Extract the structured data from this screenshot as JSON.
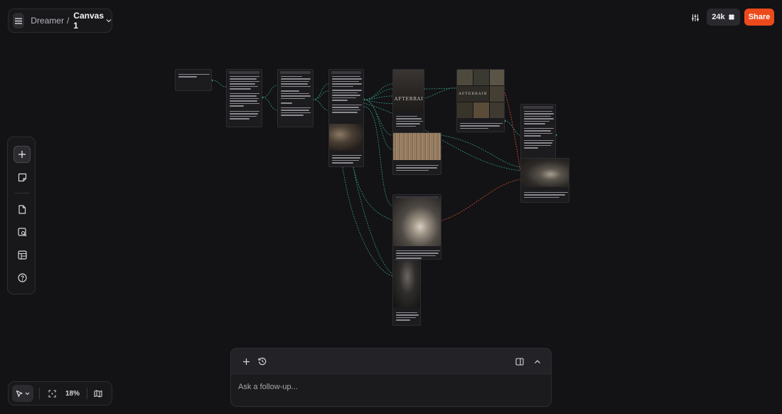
{
  "breadcrumb": {
    "root": "Dreamer",
    "separator": "/",
    "current": "Canvas 1"
  },
  "header": {
    "credits": "24k",
    "share_label": "Share"
  },
  "left_toolbar": {
    "items": [
      {
        "name": "add",
        "icon": "plus-icon"
      },
      {
        "name": "sticky-note",
        "icon": "sticky-note-icon"
      },
      {
        "name": "document",
        "icon": "document-icon"
      },
      {
        "name": "image-search",
        "icon": "image-search-icon"
      },
      {
        "name": "layout",
        "icon": "layout-icon"
      },
      {
        "name": "help",
        "icon": "help-icon"
      }
    ]
  },
  "zoom": {
    "level": "18%"
  },
  "chat": {
    "placeholder": "Ask a follow-up..."
  },
  "canvas": {
    "image_text": [
      "AFTERRAIN",
      "AFTERRAIN"
    ],
    "colors": {
      "wire": "#2e8f7a",
      "wire_red": "#c04a3a",
      "accent": "#ec4a1c",
      "background": "#131214"
    }
  }
}
